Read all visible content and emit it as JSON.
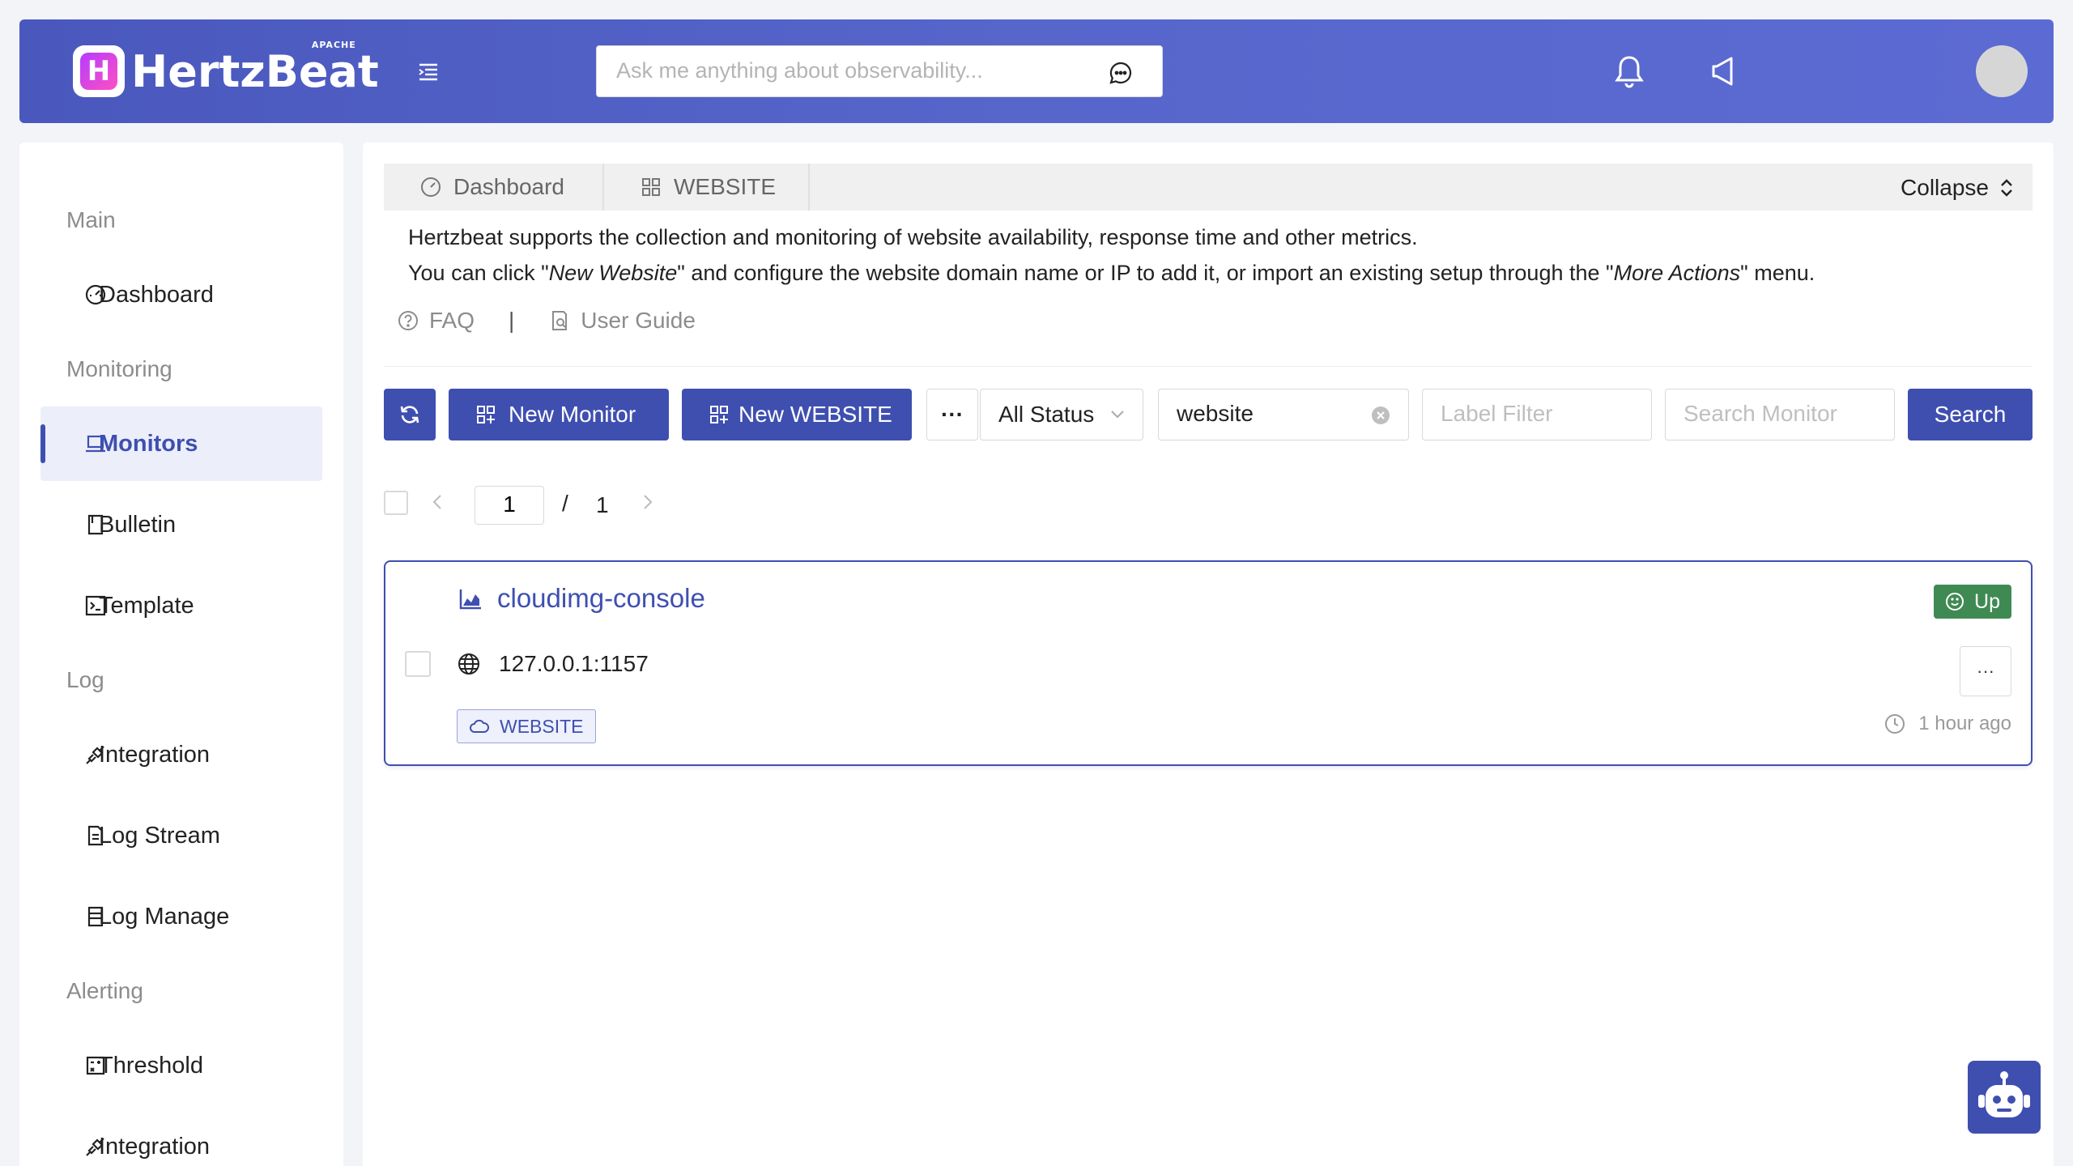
{
  "header": {
    "logo_text": "HertzBeat",
    "logo_badge": "APACHE",
    "logo_letter": "H",
    "ask_placeholder": "Ask me anything about observability...",
    "colors": {
      "gradient_start": "#4a58bd",
      "gradient_end": "#5c6bd3"
    }
  },
  "sidebar": {
    "groups": {
      "main": "Main",
      "monitoring": "Monitoring",
      "log": "Log",
      "alerting": "Alerting"
    },
    "items": [
      {
        "label": "Dashboard",
        "icon": "dashboard-icon"
      },
      {
        "label": "Monitors",
        "icon": "laptop-icon",
        "active": true
      },
      {
        "label": "Bulletin",
        "icon": "book-icon"
      },
      {
        "label": "Template",
        "icon": "code-icon"
      },
      {
        "label": "Integration",
        "icon": "api-icon"
      },
      {
        "label": "Log Stream",
        "icon": "file-icon"
      },
      {
        "label": "Log Manage",
        "icon": "table-icon"
      },
      {
        "label": "Threshold",
        "icon": "calculator-icon"
      },
      {
        "label": "Integration",
        "icon": "api-icon"
      }
    ]
  },
  "tabs": {
    "dashboard": "Dashboard",
    "website": "WEBSITE",
    "collapse": "Collapse"
  },
  "description": {
    "line1": "Hertzbeat supports the collection and monitoring of website availability, response time and other metrics.",
    "line2_a": "You can click \"",
    "line2_new": "New Website",
    "line2_b": "\" and configure the website domain name or IP to add it, or import an existing setup through the \"",
    "line2_more": "More Actions",
    "line2_c": "\" menu.",
    "faq": "FAQ",
    "separator": "|",
    "user_guide": "User Guide"
  },
  "toolbar": {
    "new_monitor": "New Monitor",
    "new_website": "New WEBSITE",
    "more": "···",
    "status_select": "All Status",
    "type_filter_value": "website",
    "label_filter_placeholder": "Label Filter",
    "search_placeholder": "Search Monitor",
    "search_button": "Search"
  },
  "pager": {
    "current": "1",
    "slash": "/",
    "total": "1"
  },
  "monitor": {
    "name": "cloudimg-console",
    "host": "127.0.0.1:1157",
    "tag": "WEBSITE",
    "status": "Up",
    "time": "1 hour ago",
    "more": "···",
    "colors": {
      "status": "#3f8a53",
      "primary": "#3f4fb0"
    }
  }
}
